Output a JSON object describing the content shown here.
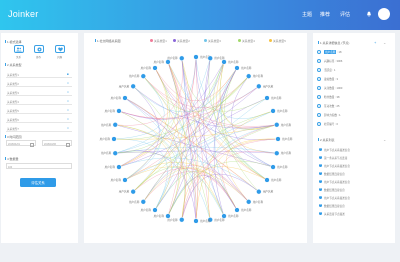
{
  "header": {
    "logo": "Joinker",
    "nav": [
      "主题",
      "推荐",
      "评估"
    ]
  },
  "left_panel": {
    "mode_title": "1 模式选择",
    "modes": [
      {
        "label": "关系",
        "icon": "users-icon"
      },
      {
        "label": "协作",
        "icon": "network-icon"
      },
      {
        "label": "兴趣",
        "icon": "heart-icon"
      }
    ],
    "filter_title": "2 关系类型",
    "filters": [
      {
        "label": "关系类型1",
        "checked": true
      },
      {
        "label": "关系类型2",
        "checked": false
      },
      {
        "label": "关系类型3",
        "checked": false
      },
      {
        "label": "关系类型4",
        "checked": false
      },
      {
        "label": "关系类型5",
        "checked": false
      },
      {
        "label": "关系类型6",
        "checked": false
      },
      {
        "label": "关系类型7",
        "checked": false
      }
    ],
    "time_title": "3 时间范围",
    "date_from": "2018/01/01",
    "date_to": "2018/10/06",
    "count_title": "4 数据量",
    "count_value": "100",
    "eval_button": "评估关系"
  },
  "center_panel": {
    "title": "1 社交网络关系图",
    "legend": [
      {
        "label": "关系类型1",
        "color": "#f07c9a"
      },
      {
        "label": "关系类型2",
        "color": "#8a66d9"
      },
      {
        "label": "关系类型3",
        "color": "#71c5ea"
      },
      {
        "label": "关系类型4",
        "color": "#a2d86a"
      },
      {
        "label": "关系类型5",
        "color": "#f5c242"
      }
    ],
    "node_label": "用户名称",
    "node_count": 36
  },
  "right_panel": {
    "title": "1 关系详细信息 (节点)",
    "rows": [
      {
        "label": "用户名称",
        "value": "18",
        "highlight": true
      },
      {
        "label": "兴趣标签",
        "value": "3006"
      },
      {
        "label": "活跃度",
        "value": "1"
      },
      {
        "label": "发帖数量",
        "value": "3"
      },
      {
        "label": "关注数量",
        "value": "1000"
      },
      {
        "label": "粉丝数量",
        "value": "38"
      },
      {
        "label": "互动次数",
        "value": "25"
      },
      {
        "label": "影响力指数",
        "value": "1"
      },
      {
        "label": "社区编号",
        "value": "0"
      }
    ],
    "list_title": "2 关系列表",
    "list": [
      "用户节点关系描述信息",
      "第一条关系节点连接",
      "用户节点关系描述信息",
      "数据结果连接信息",
      "用户节点关系描述信息",
      "数据结果连接信息",
      "用户节点关系描述信息",
      "数据结果连接信息",
      "关系连接节点描述"
    ]
  }
}
